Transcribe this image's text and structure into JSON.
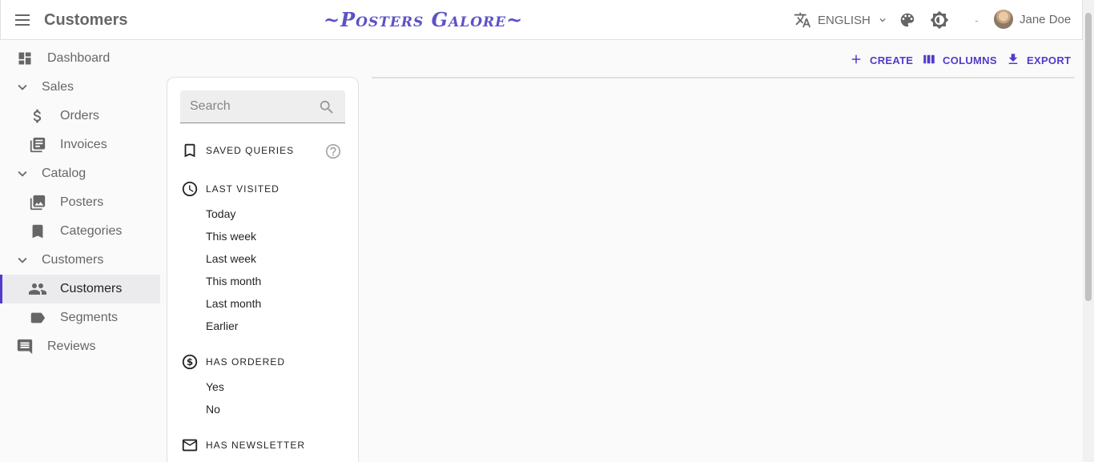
{
  "appbar": {
    "title": "Customers",
    "brand": "~Posters Galore~",
    "language": "ENGLISH",
    "user_name": "Jane Doe"
  },
  "sidebar": {
    "dashboard": "Dashboard",
    "sales": "Sales",
    "orders": "Orders",
    "invoices": "Invoices",
    "catalog": "Catalog",
    "posters": "Posters",
    "categories": "Categories",
    "customers_group": "Customers",
    "customers": "Customers",
    "segments": "Segments",
    "reviews": "Reviews"
  },
  "toolbar": {
    "create": "CREATE",
    "columns": "COLUMNS",
    "export": "EXPORT"
  },
  "filters": {
    "search_placeholder": "Search",
    "saved_queries": "SAVED QUERIES",
    "last_visited": {
      "title": "LAST VISITED",
      "options": [
        "Today",
        "This week",
        "Last week",
        "This month",
        "Last month",
        "Earlier"
      ]
    },
    "has_ordered": {
      "title": "HAS ORDERED",
      "options": [
        "Yes",
        "No"
      ]
    },
    "has_newsletter": {
      "title": "HAS NEWSLETTER"
    }
  },
  "colors": {
    "accent": "#4f3cc9",
    "brand": "#5b52c7",
    "active_bg": "#ebebee"
  }
}
